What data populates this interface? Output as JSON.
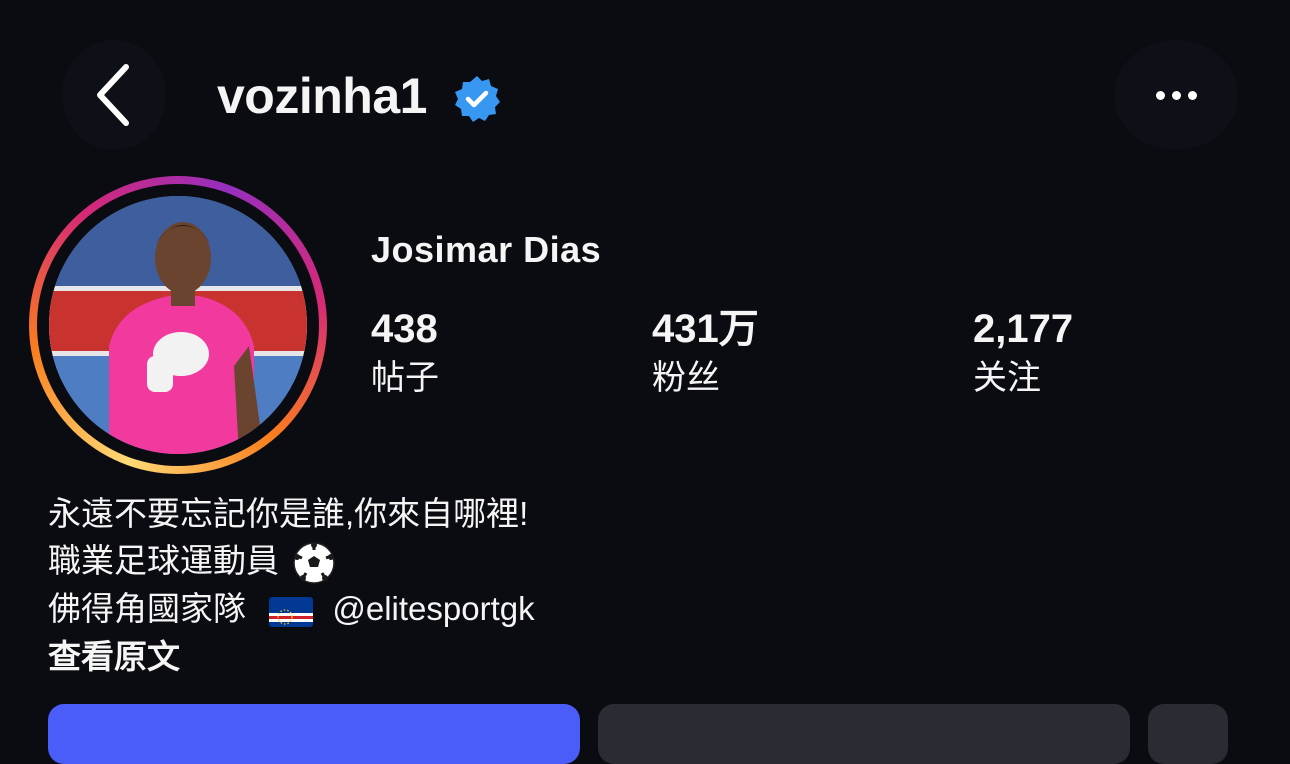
{
  "header": {
    "back_icon": "chevron-left-icon",
    "username": "vozinha1",
    "verified_icon": "verified-badge-icon",
    "more_icon": "ellipsis-horizontal-icon"
  },
  "profile": {
    "full_name": "Josimar Dias",
    "avatar_description": "goalkeeper in pink kit with hand on chest"
  },
  "stats": [
    {
      "value": "438",
      "label": "帖子"
    },
    {
      "value": "431万",
      "label": "粉丝"
    },
    {
      "value": "2,177",
      "label": "关注"
    }
  ],
  "bio": {
    "line1": "永遠不要忘記你是誰,你來自哪裡!",
    "line2": "職業足球運動員",
    "line2_emoji": "soccer-ball-icon",
    "line3_text": "佛得角國家隊",
    "line3_flag": "cape-verde-flag-icon",
    "line3_mention": "@elitesportgk",
    "see_original": "查看原文"
  },
  "colors": {
    "background": "#0b0c12",
    "verified": "#3897f0",
    "follow_button": "#4a5df9",
    "secondary_button": "#2a2c33"
  }
}
